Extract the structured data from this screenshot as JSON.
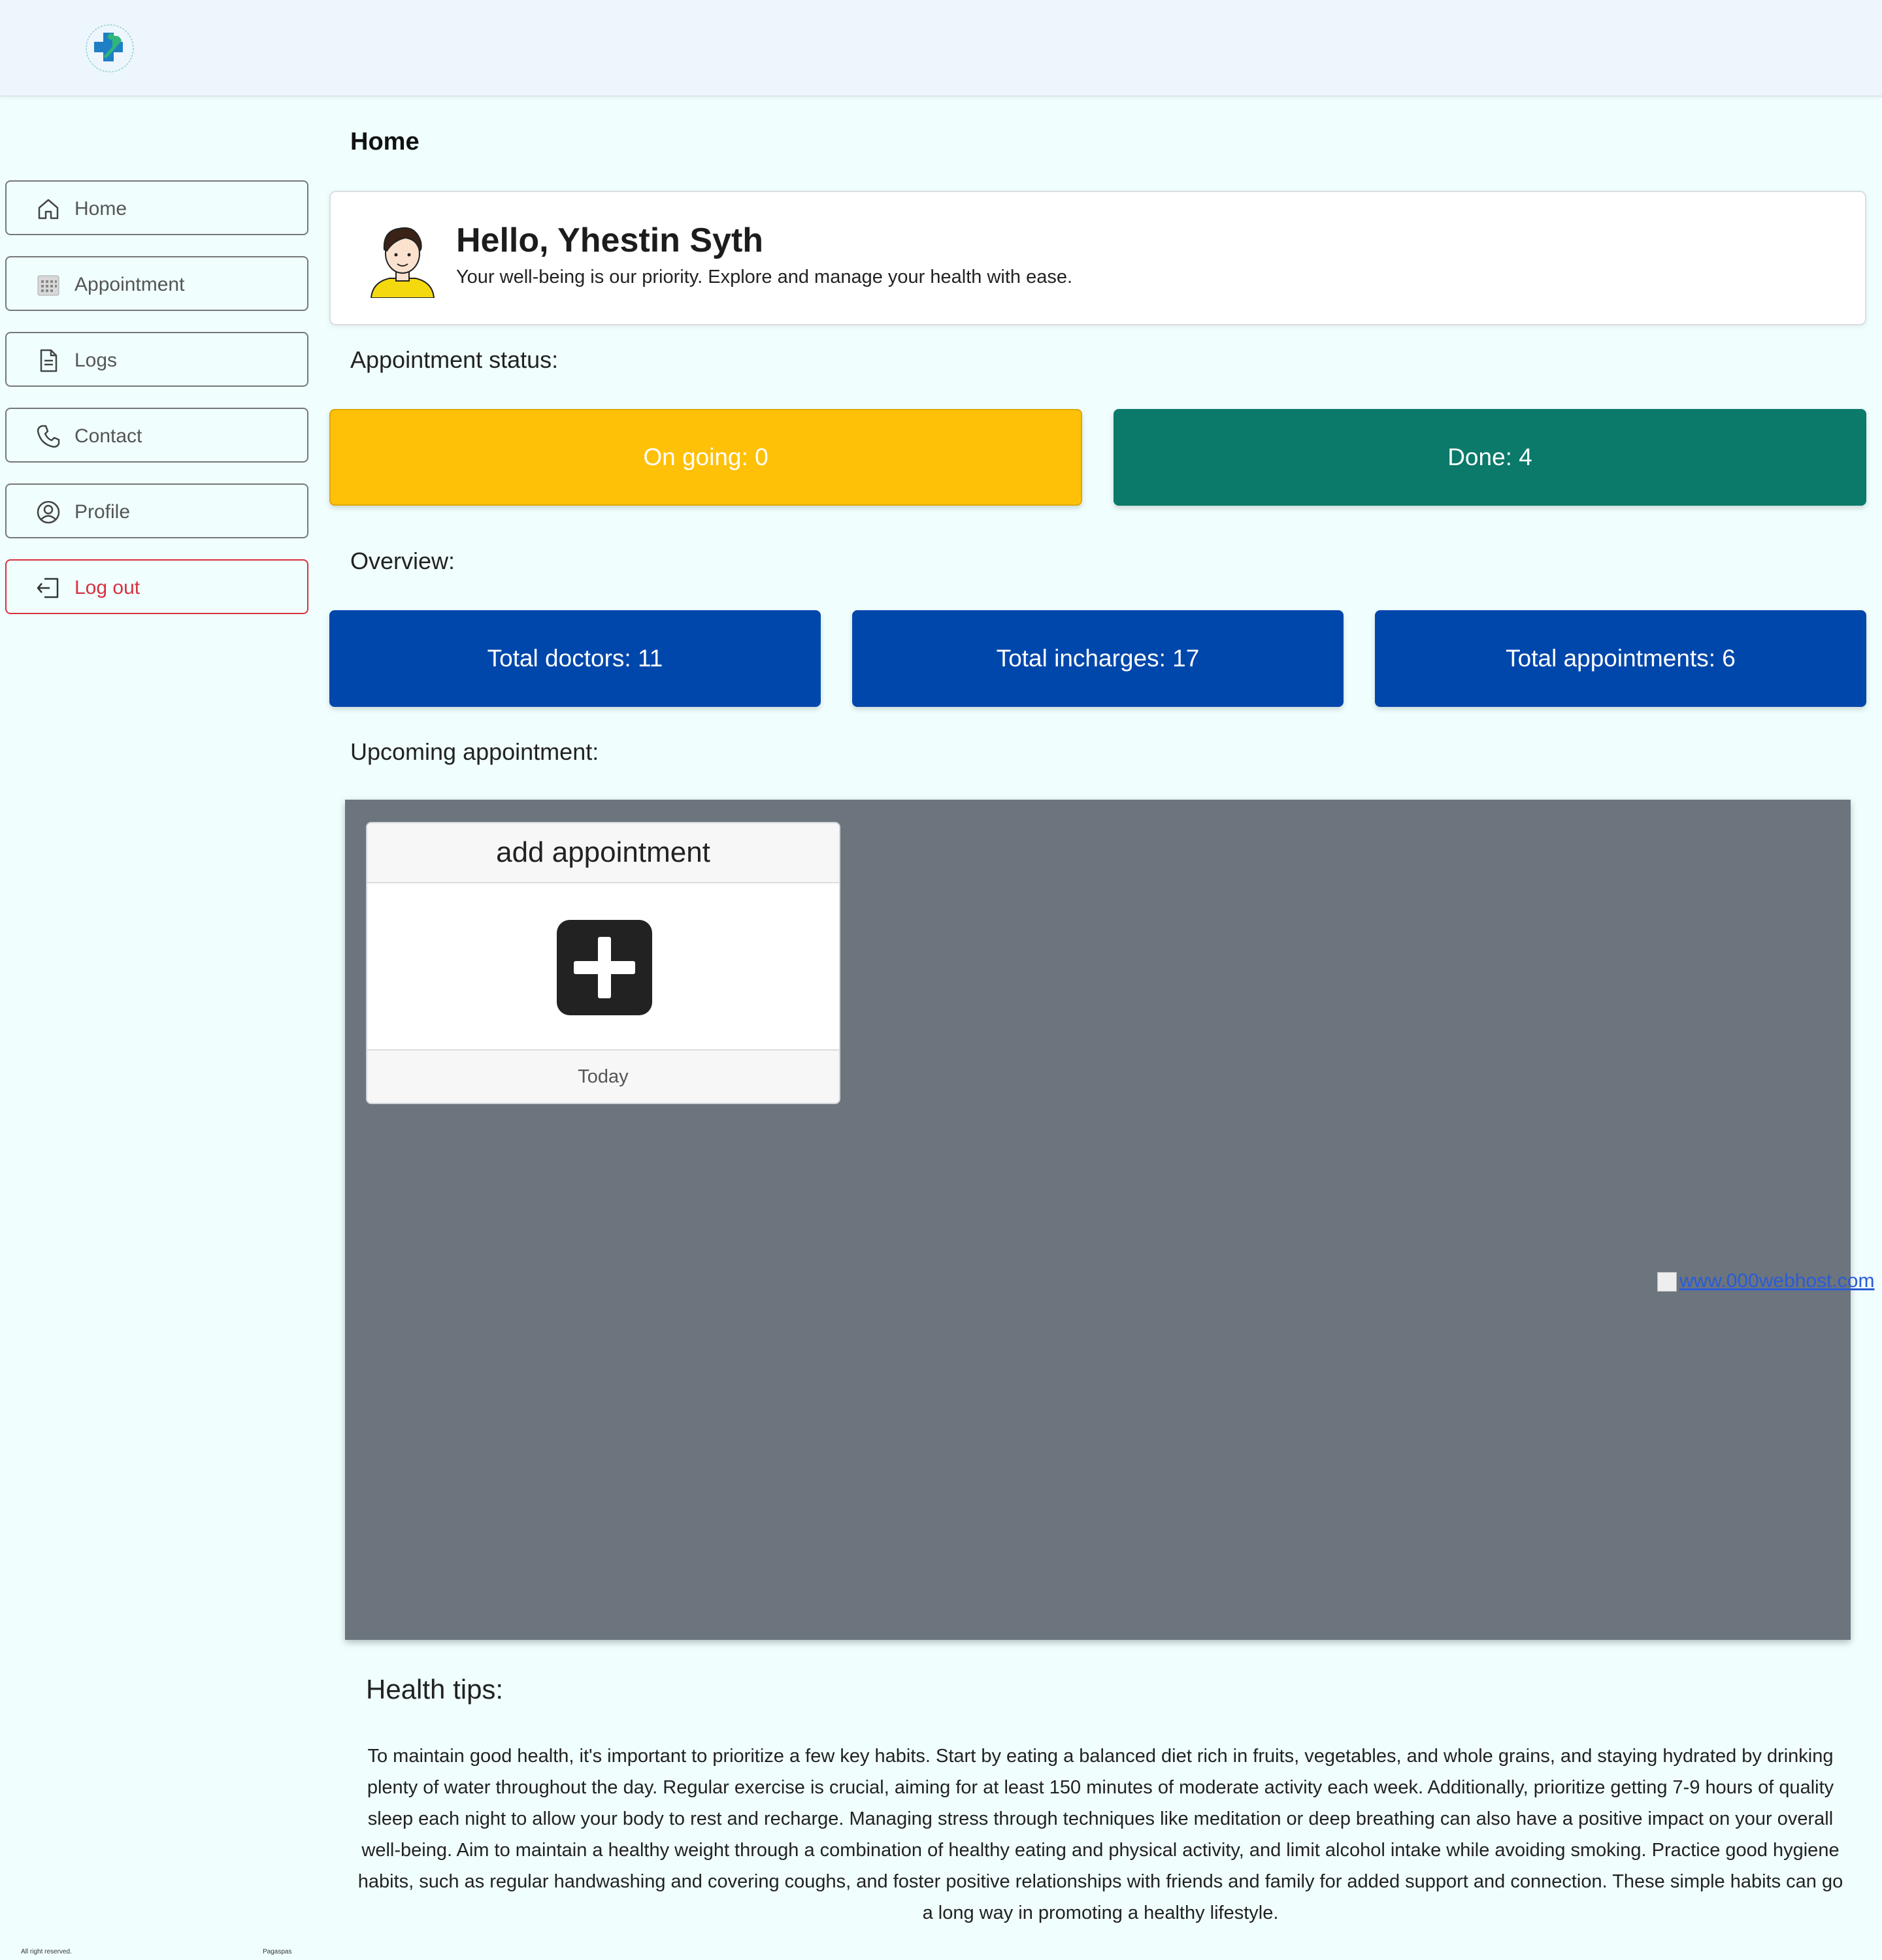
{
  "header": {
    "logo_name": "clinic-logo"
  },
  "sidebar": {
    "items": [
      {
        "label": "Home",
        "icon": "home-icon"
      },
      {
        "label": "Appointment",
        "icon": "calendar-icon"
      },
      {
        "label": "Logs",
        "icon": "document-icon"
      },
      {
        "label": "Contact",
        "icon": "phone-icon"
      },
      {
        "label": "Profile",
        "icon": "user-circle-icon"
      },
      {
        "label": "Log out",
        "icon": "logout-icon"
      }
    ]
  },
  "main": {
    "page_title": "Home",
    "greeting": "Hello, Yhestin Syth",
    "greeting_sub": "Your well-being is our priority. Explore and manage your health with ease.",
    "status_label": "Appointment status:",
    "status": {
      "ongoing": "On going: 0",
      "done": "Done: 4"
    },
    "overview_label": "Overview:",
    "overview": {
      "doctors": "Total doctors: 11",
      "incharges": "Total incharges: 17",
      "appointments": "Total appointments: 6"
    },
    "upcoming_label": "Upcoming appointment:",
    "add_card": {
      "title": "add appointment",
      "footer": "Today"
    },
    "host_link": "www.000webhost.com",
    "tips_title": "Health tips:",
    "tips_body": "To maintain good health, it's important to prioritize a few key habits. Start by eating a balanced diet rich in fruits, vegetables, and whole grains, and staying hydrated by drinking plenty of water throughout the day. Regular exercise is crucial, aiming for at least 150 minutes of moderate activity each week. Additionally, prioritize getting 7-9 hours of quality sleep each night to allow your body to rest and recharge. Managing stress through techniques like meditation or deep breathing can also have a positive impact on your overall well-being. Aim to maintain a healthy weight through a combination of healthy eating and physical activity, and limit alcohol intake while avoiding smoking. Practice good hygiene habits, such as regular handwashing and covering coughs, and foster positive relationships with friends and family for added support and connection. These simple habits can go a long way in promoting a healthy lifestyle."
  },
  "footer": {
    "left": "All right reserved.",
    "right": "Pagaspas"
  },
  "colors": {
    "ongoing": "#ffc107",
    "done": "#0b7a6a",
    "overview": "#0047ab",
    "upcoming_bg": "#6c757d",
    "logout": "#d9303e"
  }
}
